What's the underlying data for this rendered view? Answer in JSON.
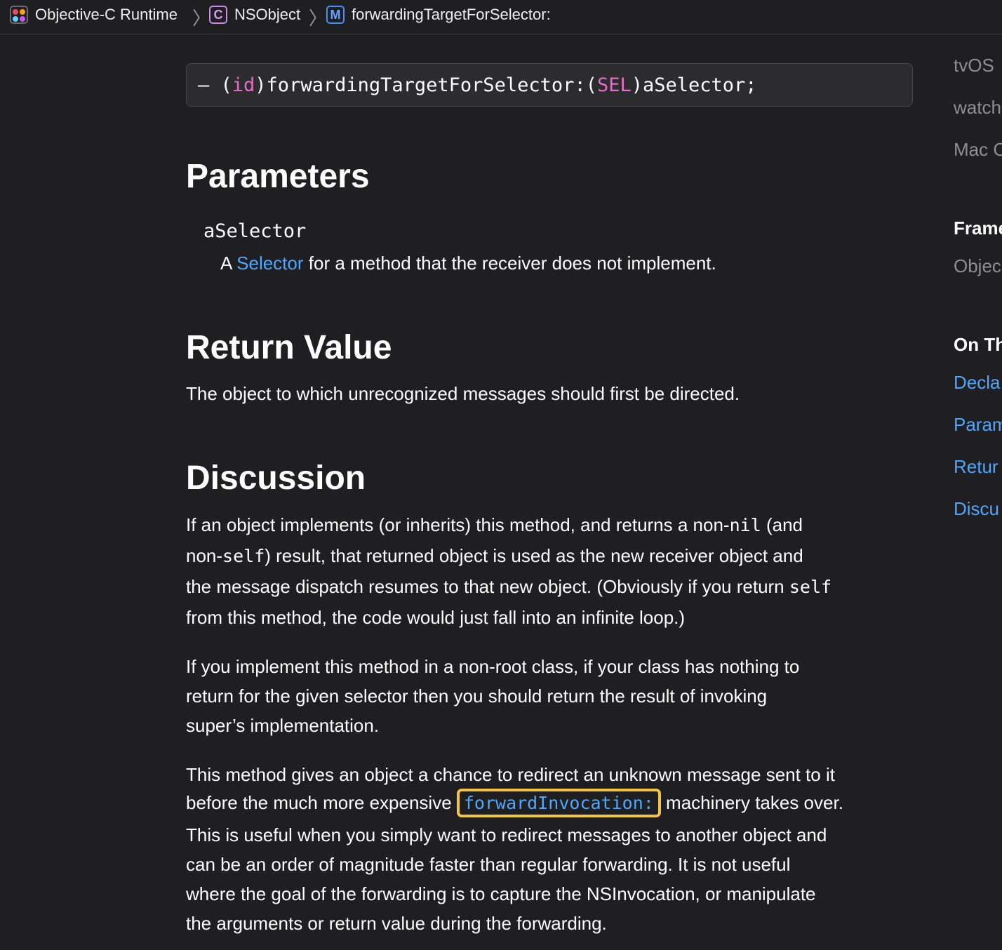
{
  "breadcrumb": {
    "items": [
      {
        "label": "Objective-C Runtime",
        "badge": "framework"
      },
      {
        "label": "NSObject",
        "badge": "C"
      },
      {
        "label": "forwardingTargetForSelector:",
        "badge": "M"
      }
    ],
    "separator": "〉",
    "badge_colors": {
      "class": "#c48ae8",
      "method": "#4b8ef5",
      "framework_dots": [
        "#e6486b",
        "#ff9f0a",
        "#64d2ff",
        "#bf5af2"
      ]
    }
  },
  "declaration": {
    "prefix": "– (",
    "return_type": "id",
    "name": ")forwardingTargetForSelector:(",
    "param_type": "SEL",
    "suffix": ")aSelector;"
  },
  "parameters": {
    "heading": "Parameters",
    "name": "aSelector",
    "desc_prefix": "A ",
    "desc_link": "Selector",
    "desc_suffix": " for a method that the receiver does not implement."
  },
  "return_value": {
    "heading": "Return Value",
    "text": "The object to which unrecognized messages should first be directed."
  },
  "discussion": {
    "heading": "Discussion",
    "p1": {
      "a": "If an object implements (or inherits) this method, and returns a non-",
      "code1": "nil",
      "b": " (and",
      "c": "non-",
      "code2": "self",
      "d": ") result, that returned object is used as the new receiver object and",
      "e": "the message dispatch resumes to that new object. (Obviously if you return ",
      "code3": "self",
      "f": "from this method, the code would just fall into an infinite loop.)"
    },
    "p2": {
      "l1": "If you implement this method in a non-root class, if your class has nothing to",
      "l2": "return for the given selector then you should return the result of invoking",
      "l3": "super’s implementation."
    },
    "p3": {
      "l1": "This method gives an object a chance to redirect an unknown message sent to it",
      "l2a": "before the much more expensive ",
      "link": "forwardInvocation:",
      "l2b": " machinery takes over.",
      "l3": "This is useful when you simply want to redirect messages to another object and",
      "l4": "can be an order of magnitude faster than regular forwarding. It is not useful",
      "l5": "where the goal of the forwarding is to capture the NSInvocation, or manipulate",
      "l6": "the arguments or return value during the forwarding."
    }
  },
  "sidebar": {
    "platforms": [
      "tvOS",
      "watch",
      "Mac C"
    ],
    "framework_heading": "Frame",
    "framework_value": "Objec",
    "on_this_page_heading": "On Th",
    "links": [
      "Decla",
      "Param",
      "Retur",
      "Discu"
    ]
  }
}
